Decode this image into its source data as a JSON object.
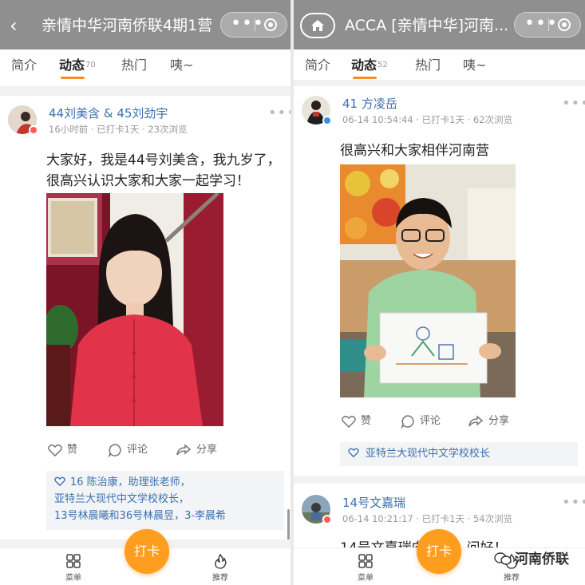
{
  "left": {
    "title": "亲情中华河南侨联4期1营",
    "tabs": [
      {
        "label": "简介"
      },
      {
        "label": "动态",
        "count": "70"
      },
      {
        "label": "热门"
      },
      {
        "label": "咦~"
      }
    ],
    "post": {
      "author": "44刘美含 & 45刘劲宇",
      "meta": "16小时前 · 已打卡1天 · 23次浏览",
      "content_line1": "大家好，我是44号刘美含，我九岁了，",
      "content_line2": "很高兴认识大家和大家一起学习！",
      "actions": {
        "like": "赞",
        "comment": "评论",
        "share": "分享"
      },
      "likes_line1": "16 陈治康，助理张老师，",
      "likes_line2": "亚特兰大现代中文学校校长，",
      "likes_line3": "13号林晨曦和36号林晨昱，3-李晨希"
    },
    "bottom_nav": {
      "menu": "菜单",
      "punch": "打卡",
      "recommend": "推荐"
    }
  },
  "right": {
    "title": "ACCA [亲情中华]河南...",
    "tabs": [
      {
        "label": "简介"
      },
      {
        "label": "动态",
        "count": "52"
      },
      {
        "label": "热门"
      },
      {
        "label": "咦~"
      }
    ],
    "post1": {
      "author": "41 方凌岳",
      "meta": "06-14 10:54:44 · 已打卡1天 · 62次浏览",
      "content": "很高兴和大家相伴河南营",
      "actions": {
        "like": "赞",
        "comment": "评论",
        "share": "分享"
      },
      "likes": "亚特兰大现代中文学校校长"
    },
    "post2": {
      "author": "14号文嘉瑞",
      "meta": "06-14 10:21:17 · 已打卡1天 · 54次浏览",
      "content_partial": "14号文嘉瑞向",
      "content_partial2": "问好！"
    },
    "bottom_nav": {
      "menu": "菜单",
      "punch": "打卡",
      "recommend": "推荐"
    },
    "watermark": "河南侨联"
  },
  "colors": {
    "accent": "#ff9d1e",
    "link": "#3a6fb0",
    "topbar": "#8f8f8f"
  }
}
